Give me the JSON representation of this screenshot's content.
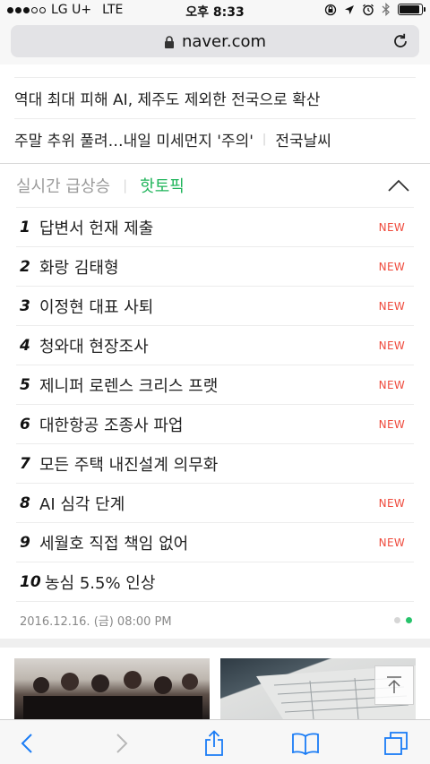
{
  "status_bar": {
    "carrier": "LG U+",
    "network": "LTE",
    "time": "오후 8:33",
    "signal_bars": 3,
    "signal_total": 5,
    "battery_level": 0.9
  },
  "browser": {
    "url": "naver.com"
  },
  "news": {
    "headline_1": "역대 최대 피해 AI, 제주도 제외한 전국으로 확산",
    "headline_2": "주말 추위 풀려…내일 미세먼지 '주의'",
    "headline_2_tag": "전국날씨"
  },
  "realtime": {
    "tab_rising": "실시간 급상승",
    "tab_hot": "핫토픽",
    "items": [
      {
        "rank": "1",
        "text": "답변서 헌재 제출",
        "badge": "NEW"
      },
      {
        "rank": "2",
        "text": "화랑 김태형",
        "badge": "NEW"
      },
      {
        "rank": "3",
        "text": "이정현 대표 사퇴",
        "badge": "NEW"
      },
      {
        "rank": "4",
        "text": "청와대 현장조사",
        "badge": "NEW"
      },
      {
        "rank": "5",
        "text": "제니퍼 로렌스 크리스 프랫",
        "badge": "NEW"
      },
      {
        "rank": "6",
        "text": "대한항공 조종사 파업",
        "badge": "NEW"
      },
      {
        "rank": "7",
        "text": "모든 주택 내진설계 의무화",
        "badge": ""
      },
      {
        "rank": "8",
        "text": "AI 심각 단계",
        "badge": "NEW"
      },
      {
        "rank": "9",
        "text": "세월호 직접 책임 없어",
        "badge": "NEW"
      },
      {
        "rank": "10",
        "text": "농심 5.5% 인상",
        "badge": ""
      }
    ],
    "timestamp": "2016.12.16. (금) 08:00 PM",
    "page_total": 2,
    "page_current": 2
  },
  "colors": {
    "accent_green": "#1fb45a",
    "new_red": "#ef4b3d",
    "ios_blue": "#1a7cf5"
  },
  "icons": {
    "lock": "lock-icon",
    "reload": "reload-icon",
    "collapse": "chevron-up-icon",
    "scroll_top": "arrow-up-to-top-icon",
    "back": "chevron-left-icon",
    "forward": "chevron-right-icon",
    "share": "share-icon",
    "bookmarks": "book-icon",
    "tabs": "tabs-icon"
  }
}
